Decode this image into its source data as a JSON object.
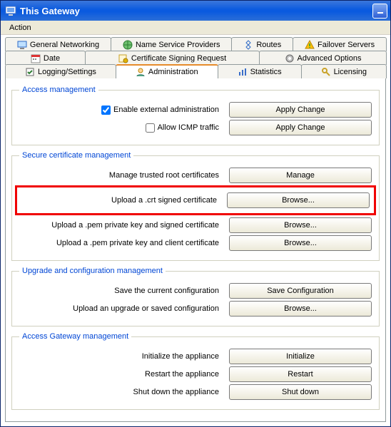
{
  "window": {
    "title": "This Gateway"
  },
  "menu": {
    "action": "Action"
  },
  "tabs": {
    "row1": [
      {
        "label": "General Networking"
      },
      {
        "label": "Name Service Providers"
      },
      {
        "label": "Routes"
      },
      {
        "label": "Failover Servers"
      }
    ],
    "row2": [
      {
        "label": "Date"
      },
      {
        "label": "Certificate Signing Request"
      },
      {
        "label": "Advanced Options"
      }
    ],
    "row3": [
      {
        "label": "Logging/Settings"
      },
      {
        "label": "Administration"
      },
      {
        "label": "Statistics"
      },
      {
        "label": "Licensing"
      }
    ]
  },
  "groups": {
    "access": {
      "legend": "Access management",
      "external_admin_label": "Enable external administration",
      "external_admin_checked": true,
      "icmp_label": "Allow ICMP traffic",
      "icmp_checked": false,
      "apply_change": "Apply Change"
    },
    "cert": {
      "legend": "Secure certificate management",
      "manage_label": "Manage trusted root certificates",
      "manage_btn": "Manage",
      "crt_label": "Upload a .crt signed certificate",
      "browse_btn": "Browse...",
      "pem_signed_label": "Upload a .pem private key and signed certificate",
      "pem_client_label": "Upload a .pem private key and client certificate"
    },
    "upgrade": {
      "legend": "Upgrade and configuration management",
      "save_label": "Save the current configuration",
      "save_btn": "Save Configuration",
      "upload_label": "Upload an upgrade or saved configuration",
      "browse_btn": "Browse..."
    },
    "gateway": {
      "legend": "Access Gateway management",
      "init_label": "Initialize the appliance",
      "init_btn": "Initialize",
      "restart_label": "Restart the appliance",
      "restart_btn": "Restart",
      "shutdown_label": "Shut down the appliance",
      "shutdown_btn": "Shut down"
    }
  }
}
